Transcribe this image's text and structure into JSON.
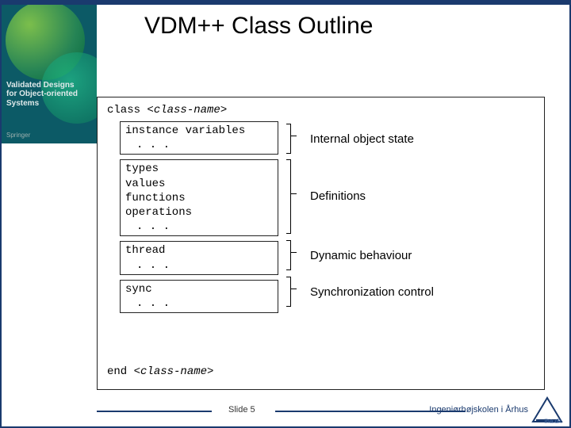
{
  "title": "VDM++ Class Outline",
  "book": {
    "title_line1": "Validated Designs",
    "title_line2": "for Object-oriented",
    "title_line3": "Systems",
    "publisher": "Springer"
  },
  "classDecl": {
    "keyword": "class",
    "name": "<class-name>"
  },
  "sections": {
    "instance": {
      "line1": "instance variables",
      "dots": ". . ."
    },
    "defs": {
      "types": "types",
      "values": "values",
      "functions": "functions",
      "operations": "operations",
      "dots": ". . ."
    },
    "thread": {
      "kw": "thread",
      "dots": ". . ."
    },
    "sync": {
      "kw": "sync",
      "dots": ". . ."
    }
  },
  "annotations": {
    "state": "Internal object state",
    "defs": "Definitions",
    "dyn": "Dynamic behaviour",
    "sync": "Synchronization control"
  },
  "endDecl": {
    "keyword": "end",
    "name": "<class-name>"
  },
  "footer": {
    "slide": "Slide 5",
    "school": "Ingeniørhøjskolen i Århus",
    "domain": "iha.dk"
  }
}
